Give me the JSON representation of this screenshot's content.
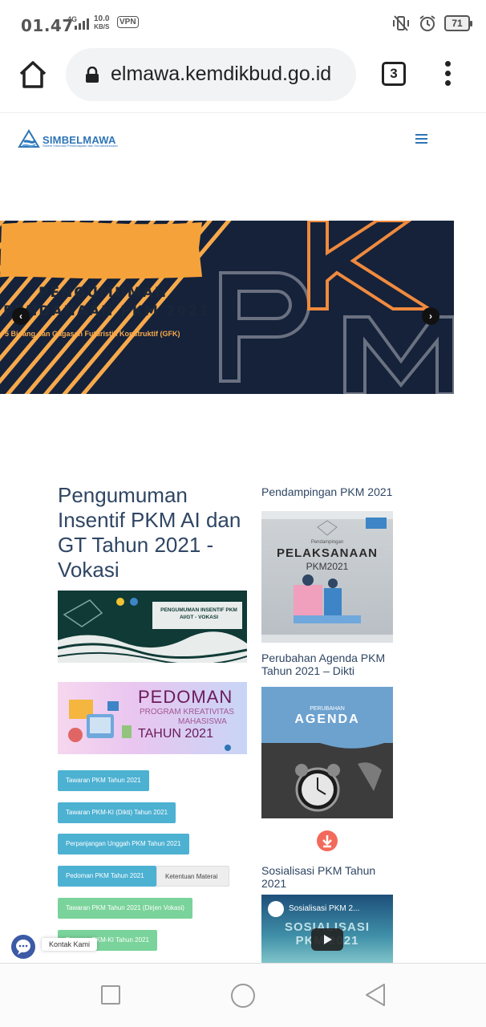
{
  "status_bar": {
    "time": "01.47",
    "network": "4G",
    "speed_value": "10.0",
    "speed_unit": "KB/S",
    "vpn": "VPN",
    "battery": "71"
  },
  "browser": {
    "url": "elmawa.kemdikbud.go.id",
    "tab_count": "3"
  },
  "site": {
    "logo_text": "SIMBELMAWA",
    "logo_subtext": "Sistem Informasi Pembelajaran dan Kemahasiswaan"
  },
  "banner": {
    "line1": "PENGUMUMAN",
    "line2": "PENDANAAN PKM 2021",
    "subtitle": "5 Bidang dan Gagasan Futuristik Konstruktif (GFK)",
    "big_letters": "PKM",
    "prev": "‹",
    "next": "›"
  },
  "main": {
    "title": "Pengumuman Insentif PKM AI dan GT Tahun 2021 - Vokasi",
    "insentif_image_text": "PENGUMUMAN INSENTIF PKM AI/GT - VOKASI",
    "pedoman_image": {
      "line1": "PEDOMAN",
      "line2": "PROGRAM KREATIVITAS",
      "line3": "MAHASISWA",
      "line4": "TAHUN 2021"
    },
    "buttons": [
      "Tawaran PKM Tahun 2021",
      "Tawaran PKM-KI (Dikti) Tahun 2021",
      "Perpanjangan Unggah PKM Tahun 2021",
      "Pedoman PKM Tahun 2021",
      "Ketentuan Materai",
      "Tawaran PKM Tahun 2021 (Dirjen Vokasi)",
      "Tawaran PKM-KI Tahun 2021"
    ]
  },
  "sidebar": {
    "heading1": "Pendampingan PKM 2021",
    "image1": {
      "small": "Pendampingan",
      "big": "PELAKSANAAN",
      "year": "PKM2021"
    },
    "heading2": "Perubahan Agenda PKM Tahun 2021 – Dikti",
    "image2": {
      "small": "PERUBAHAN",
      "big": "AGENDA"
    },
    "heading3": "Sosialisasi PKM Tahun 2021",
    "video_title": "Sosialisasi PKM 2...",
    "video_bg_text": "SOSIALISASI PKM 2021"
  },
  "chat": {
    "label": "Kontak Kami"
  },
  "colors": {
    "heading": "#2f4664",
    "button_blue": "#4db1d2",
    "button_green": "#7ad39a",
    "banner_orange": "#f7a94b",
    "banner_navy": "#15223a"
  }
}
